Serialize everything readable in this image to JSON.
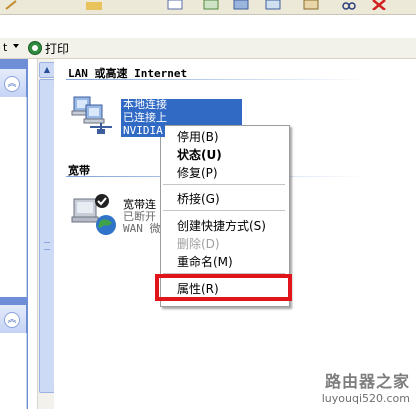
{
  "linkbar": {
    "fragment": "t",
    "print_label": "打印"
  },
  "sections": {
    "lan_title": "LAN 或高速 Internet",
    "broadband_title": "宽带"
  },
  "lan_connection": {
    "name": "本地连接",
    "status": "已连接上",
    "device": "NVIDIA"
  },
  "broadband_connection": {
    "name": "宽带连",
    "status": "已断开",
    "device": "WAN 微"
  },
  "context_menu": {
    "items": [
      {
        "label": "停用(B)"
      },
      {
        "label": "状态(U)"
      },
      {
        "label": "修复(P)"
      },
      {
        "label": "桥接(G)"
      },
      {
        "label": "创建快捷方式(S)"
      },
      {
        "label": "删除(D)"
      },
      {
        "label": "重命名(M)"
      },
      {
        "label": "属性(R)"
      }
    ]
  },
  "highlight_color": "#e0141a",
  "selection_color": "#316ac5",
  "watermark": {
    "line1": "路由器之家",
    "line2": "luyouqi520.com"
  }
}
